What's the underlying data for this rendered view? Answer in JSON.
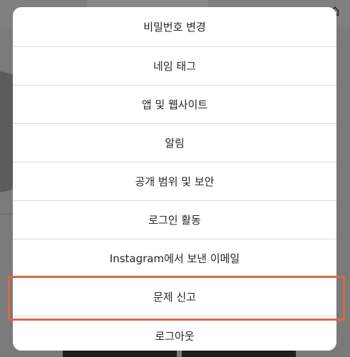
{
  "menu": {
    "items": [
      {
        "label": "비밀번호 변경"
      },
      {
        "label": "네임 태그"
      },
      {
        "label": "앱 및 웹사이트"
      },
      {
        "label": "알림"
      },
      {
        "label": "공개 범위 및 보안"
      },
      {
        "label": "로그인 활동"
      },
      {
        "label": "Instagram에서 보낸 이메일"
      },
      {
        "label": "문제 신고"
      },
      {
        "label": "로그아웃"
      }
    ]
  },
  "highlight": {
    "target": "문제 신고",
    "color": "#d4694a"
  },
  "colors": {
    "overlay": "#7a7a7a",
    "menu_bg": "#ffffff",
    "divider": "#dbdbdb",
    "text": "#262626"
  },
  "icons": {
    "home": "home-icon"
  }
}
